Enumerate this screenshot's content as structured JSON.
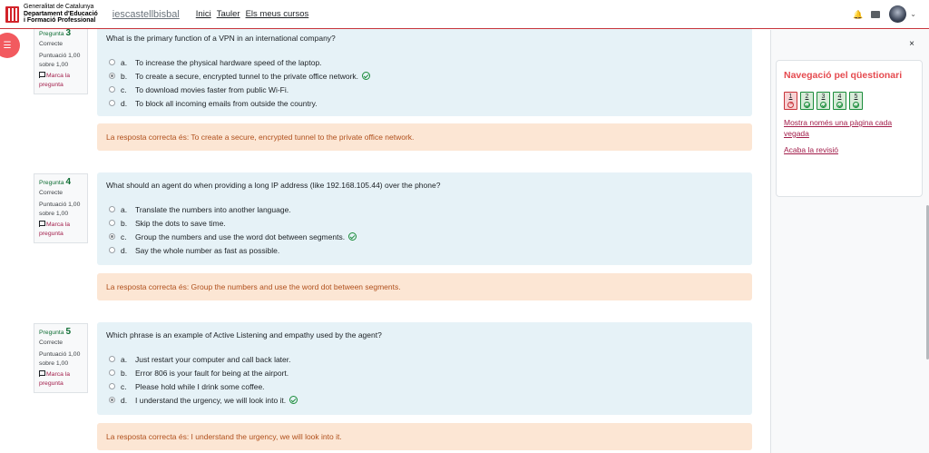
{
  "header": {
    "gencat_line1": "Generalitat de Catalunya",
    "gencat_line2": "Departament d'Educació",
    "gencat_line3": "i Formació Professional",
    "site_name": "iescastellbisbal",
    "nav": [
      "Inici",
      "Tauler",
      "Els meus cursos"
    ]
  },
  "questions": [
    {
      "label": "Pregunta",
      "number": "3",
      "state": "Correcte",
      "grade": "Puntuació 1,00 sobre 1,00",
      "flag": "Marca la pregunta",
      "text": "What is the primary function of a VPN in an international company?",
      "answers": [
        {
          "letter": "a.",
          "text": "To increase the physical hardware speed of the laptop.",
          "checked": false,
          "correct": false
        },
        {
          "letter": "b.",
          "text": "To create a secure, encrypted tunnel to the private office network.",
          "checked": true,
          "correct": true
        },
        {
          "letter": "c.",
          "text": "To download movies faster from public Wi-Fi.",
          "checked": false,
          "correct": false
        },
        {
          "letter": "d.",
          "text": "To block all incoming emails from outside the country.",
          "checked": false,
          "correct": false
        }
      ],
      "feedback": "La resposta correcta és: To create a secure, encrypted tunnel to the private office network."
    },
    {
      "label": "Pregunta",
      "number": "4",
      "state": "Correcte",
      "grade": "Puntuació 1,00 sobre 1,00",
      "flag": "Marca la pregunta",
      "text": "What should an agent do when providing a long IP address (like 192.168.105.44) over the phone?",
      "answers": [
        {
          "letter": "a.",
          "text": "Translate the numbers into another language.",
          "checked": false,
          "correct": false
        },
        {
          "letter": "b.",
          "text": "Skip the dots to save time.",
          "checked": false,
          "correct": false
        },
        {
          "letter": "c.",
          "text": "Group the numbers and use the word dot between segments.",
          "checked": true,
          "correct": true
        },
        {
          "letter": "d.",
          "text": "Say the whole number as fast as possible.",
          "checked": false,
          "correct": false
        }
      ],
      "feedback": "La resposta correcta és: Group the numbers and use the word dot between segments."
    },
    {
      "label": "Pregunta",
      "number": "5",
      "state": "Correcte",
      "grade": "Puntuació 1,00 sobre 1,00",
      "flag": "Marca la pregunta",
      "text": "Which phrase is an example of Active Listening and empathy used by the agent?",
      "answers": [
        {
          "letter": "a.",
          "text": "Just restart your computer and call back later.",
          "checked": false,
          "correct": false
        },
        {
          "letter": "b.",
          "text": "Error 806 is your fault for being at the airport.",
          "checked": false,
          "correct": false
        },
        {
          "letter": "c.",
          "text": "Please hold while I drink some coffee.",
          "checked": false,
          "correct": false
        },
        {
          "letter": "d.",
          "text": "I understand the urgency, we will look into it.",
          "checked": true,
          "correct": true
        }
      ],
      "feedback": "La resposta correcta és: I understand the urgency, we will look into it."
    }
  ],
  "drawer": {
    "close": "×",
    "title": "Navegació pel qüestionari",
    "buttons": [
      {
        "n": "1",
        "status": "incorrect"
      },
      {
        "n": "2",
        "status": "correct"
      },
      {
        "n": "3",
        "status": "correct"
      },
      {
        "n": "4",
        "status": "correct"
      },
      {
        "n": "5",
        "status": "correct"
      }
    ],
    "link_one_page": "Mostra només una pàgina cada vegada",
    "link_finish": "Acaba la revisió"
  },
  "colors": {
    "accent": "#e54a4f",
    "correct": "#1a8c3a",
    "feedback_bg": "#fce6d4",
    "formulation_bg": "#e6f2f7"
  }
}
